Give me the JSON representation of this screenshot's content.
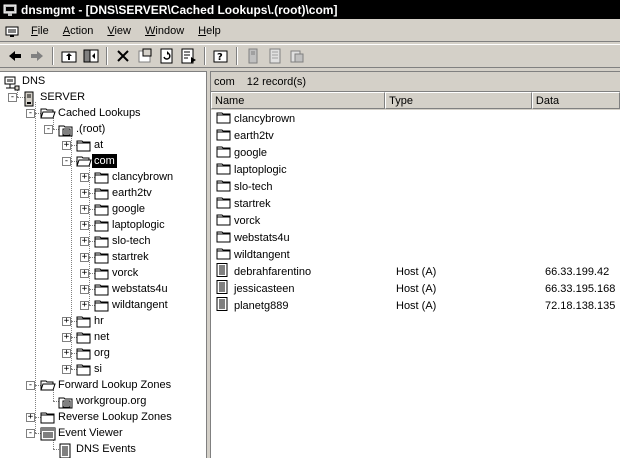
{
  "window": {
    "title": "dnsmgmt - [DNS\\SERVER\\Cached Lookups\\.(root)\\com]"
  },
  "menu": {
    "items": [
      {
        "label_first": "F",
        "label_rest": "ile"
      },
      {
        "label_first": "A",
        "label_rest": "ction"
      },
      {
        "label_first": "V",
        "label_rest": "iew"
      },
      {
        "label_first": "W",
        "label_rest": "indow"
      },
      {
        "label_first": "H",
        "label_rest": "elp"
      }
    ]
  },
  "toolbar": {
    "icons": [
      "back-arrow-icon",
      "forward-arrow-icon",
      "up-folder-icon",
      "show-hide-tree-icon",
      "delete-icon",
      "properties-icon",
      "refresh-icon",
      "export-list-icon",
      "help-icon",
      "new-host-icon",
      "new-alias-icon",
      "new-mail-exchanger-icon"
    ]
  },
  "tree": {
    "root": "DNS",
    "server": "SERVER",
    "cached": "Cached Lookups",
    "root_zone": ".(root)",
    "at": "at",
    "com": "com",
    "com_children": [
      "clancybrown",
      "earth2tv",
      "google",
      "laptoplogic",
      "slo-tech",
      "startrek",
      "vorck",
      "webstats4u",
      "wildtangent"
    ],
    "hr": "hr",
    "net": "net",
    "org": "org",
    "si": "si",
    "forward": "Forward Lookup Zones",
    "workgroup": "workgroup.org",
    "reverse": "Reverse Lookup Zones",
    "event_viewer": "Event Viewer",
    "dns_events": "DNS Events"
  },
  "list": {
    "zone_name": "com",
    "record_count": "12 record(s)",
    "columns": [
      "Name",
      "Type",
      "Data"
    ],
    "rows": [
      {
        "name": "clancybrown",
        "type": "",
        "data": "",
        "icon": "folder"
      },
      {
        "name": "earth2tv",
        "type": "",
        "data": "",
        "icon": "folder"
      },
      {
        "name": "google",
        "type": "",
        "data": "",
        "icon": "folder"
      },
      {
        "name": "laptoplogic",
        "type": "",
        "data": "",
        "icon": "folder"
      },
      {
        "name": "slo-tech",
        "type": "",
        "data": "",
        "icon": "folder"
      },
      {
        "name": "startrek",
        "type": "",
        "data": "",
        "icon": "folder"
      },
      {
        "name": "vorck",
        "type": "",
        "data": "",
        "icon": "folder"
      },
      {
        "name": "webstats4u",
        "type": "",
        "data": "",
        "icon": "folder"
      },
      {
        "name": "wildtangent",
        "type": "",
        "data": "",
        "icon": "folder"
      },
      {
        "name": "debrahfarentino",
        "type": "Host (A)",
        "data": "66.33.199.42",
        "icon": "record"
      },
      {
        "name": "jessicasteen",
        "type": "Host (A)",
        "data": "66.33.195.168",
        "icon": "record"
      },
      {
        "name": "planetg889",
        "type": "Host (A)",
        "data": "72.18.138.135",
        "icon": "record"
      }
    ]
  }
}
